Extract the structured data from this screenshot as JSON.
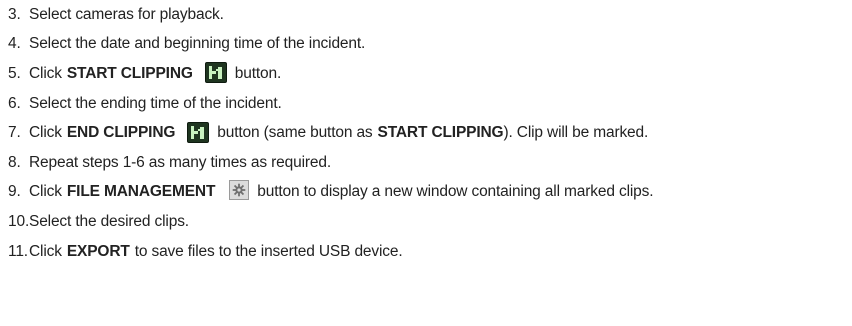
{
  "steps": [
    {
      "num": "3.",
      "text": "Select cameras for playback."
    },
    {
      "num": "4.",
      "text": "Select the date and beginning time of the incident."
    },
    {
      "num": "5.",
      "pre": "Click",
      "bold": "START CLIPPING",
      "icon": "clip-marker-icon",
      "post": "button."
    },
    {
      "num": "6.",
      "text": "Select the ending time of the incident."
    },
    {
      "num": "7.",
      "pre": "Click",
      "bold": "END CLIPPING",
      "icon": "clip-marker-icon",
      "post": "button (same button as",
      "bold2": "START CLIPPING",
      "post2": "). Clip will be marked."
    },
    {
      "num": "8.",
      "text": "Repeat steps 1-6 as many times as required."
    },
    {
      "num": "9.",
      "pre": "Click",
      "bold": "FILE MANAGEMENT",
      "icon": "gear-icon",
      "post": "button to display a new window containing all marked clips."
    },
    {
      "num": "10.",
      "text": "Select the desired clips."
    },
    {
      "num": "11.",
      "pre": "Click",
      "bold": "EXPORT",
      "post": "to save files to the inserted USB device."
    }
  ],
  "colors": {
    "text": "#222222",
    "clip_icon_bg": "#1f3520",
    "clip_icon_glyph": "#c9f2c0",
    "gear_bg": "#dcdcdc"
  }
}
